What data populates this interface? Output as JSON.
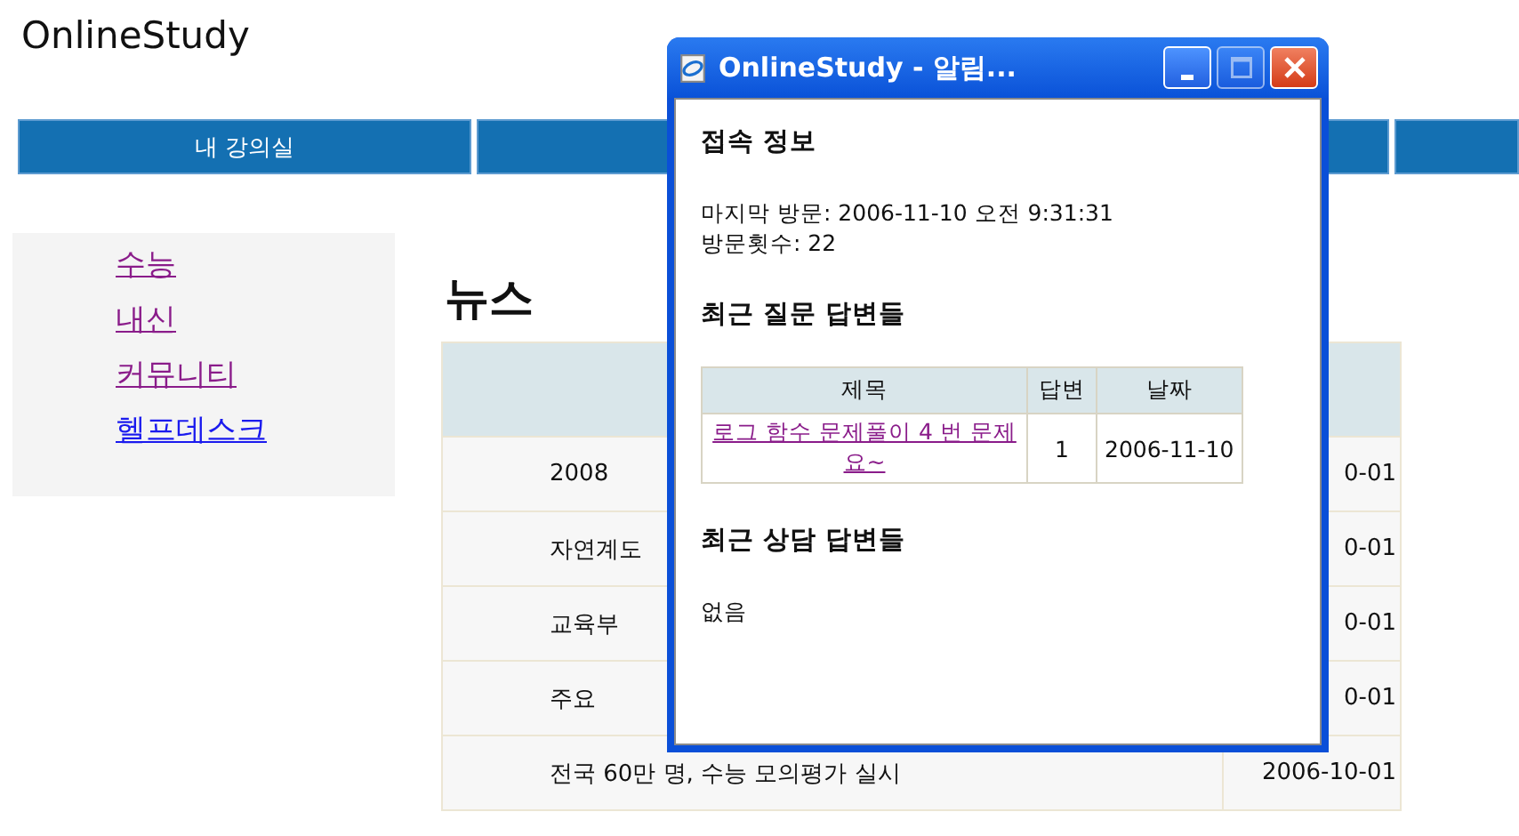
{
  "site_title": "OnlineStudy",
  "nav": [
    {
      "label": "내 강의실"
    }
  ],
  "sidebar": {
    "items": [
      {
        "label": "수능",
        "visited": true
      },
      {
        "label": "내신",
        "visited": true
      },
      {
        "label": "커뮤니티",
        "visited": true
      },
      {
        "label": "헬프데스크",
        "visited": false
      }
    ]
  },
  "heading": "뉴스",
  "news_table": {
    "rows": [
      {
        "title": "2008",
        "date": "0-01"
      },
      {
        "title": "자연계도",
        "date": "0-01"
      },
      {
        "title": "교육부",
        "date": "0-01"
      },
      {
        "title": "주요",
        "date": "0-01"
      },
      {
        "title": "전국 60만 명, 수능 모의평가 실시",
        "date": "2006-10-01"
      }
    ]
  },
  "popup": {
    "title": "OnlineStudy - 알림...",
    "title_buttons": [
      {
        "kind": "minimize",
        "disabled": false
      },
      {
        "kind": "maximize",
        "disabled": true
      },
      {
        "kind": "close",
        "disabled": false
      }
    ],
    "sections": [
      {
        "kind": "text",
        "heading": "접속 정보",
        "lines": [
          "마지막 방문: 2006-11-10 오전 9:31:31",
          "방문횟수: 22"
        ]
      },
      {
        "kind": "table",
        "heading": "최근 질문 답변들",
        "columns": [
          "제목",
          "답변",
          "날짜"
        ],
        "rows": [
          {
            "title": "로그 함수 문제풀이 4 번 문제요~",
            "answers": "1",
            "date": "2006-11-10",
            "visited": true
          }
        ]
      },
      {
        "kind": "text",
        "heading": "최근 상담 답변들",
        "lines": [
          "없음"
        ]
      }
    ]
  }
}
